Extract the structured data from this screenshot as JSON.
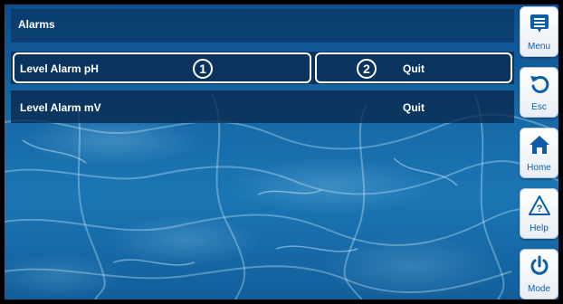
{
  "page": {
    "title": "Alarms"
  },
  "alarms": [
    {
      "label": "Level Alarm pH",
      "action": "Quit",
      "callout_name": "1",
      "callout_action": "2"
    },
    {
      "label": "Level Alarm mV",
      "action": "Quit"
    }
  ],
  "sidebar": {
    "items": [
      {
        "label": "Menu",
        "icon": "menu-icon"
      },
      {
        "label": "Esc",
        "icon": "undo-arrow-icon"
      },
      {
        "label": "Home",
        "icon": "home-icon"
      },
      {
        "label": "Help",
        "icon": "help-warning-icon"
      },
      {
        "label": "Mode",
        "icon": "power-icon"
      }
    ]
  },
  "colors": {
    "accent": "#0d5ea6",
    "row_background": "#082648",
    "water": "#176aa8",
    "text": "#ffffff"
  }
}
